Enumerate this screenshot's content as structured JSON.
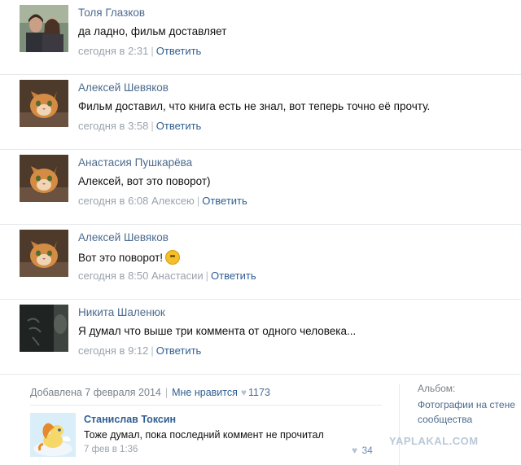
{
  "comments": [
    {
      "author": "Толя Глазков",
      "text": "да ладно, фильм доставляет",
      "date": "сегодня в 2:31",
      "reply_to": "",
      "reply_label": "Ответить",
      "avatar": "couple-photo"
    },
    {
      "author": "Алексей Шевяков",
      "text": "Фильм доставил, что книга есть не знал, вот теперь точно её прочту.",
      "date": "сегодня в 3:58",
      "reply_to": "",
      "reply_label": "Ответить",
      "avatar": "cat-photo"
    },
    {
      "author": "Анастасия Пушкарёва",
      "text": "Алексей, вот это поворот)",
      "date": "сегодня в 6:08",
      "reply_to": "Алексею",
      "reply_label": "Ответить",
      "avatar": "cat-photo"
    },
    {
      "author": "Алексей Шевяков",
      "text": "Вот это поворот!",
      "date": "сегодня в 8:50",
      "reply_to": "Анастасии",
      "reply_label": "Ответить",
      "avatar": "cat-photo",
      "emoji": "smile-emoji"
    },
    {
      "author": "Никита Шаленюк",
      "text": "Я думал что выше три коммента от одного человека...",
      "date": "сегодня в 9:12",
      "reply_to": "",
      "reply_label": "Ответить",
      "avatar": "dark-photo"
    }
  ],
  "post": {
    "added": "Добавлена 7 февраля 2014",
    "like_label": "Мне нравится",
    "like_count": "1173"
  },
  "sub_comment": {
    "author": "Станислав Токсин",
    "text": "Тоже думал, пока последний коммент не прочитал",
    "date": "7 фев в 1:36",
    "likes": "34",
    "avatar": "pony-picture"
  },
  "sidebar": {
    "label": "Альбом:",
    "link": "Фотографии на стене сообщества"
  },
  "watermark": "YAPLAKAL.COM",
  "colors": {
    "link": "#2f5f93",
    "author": "#4c6b8f",
    "meta": "#9aa3ad",
    "divider": "#e7e8ec"
  }
}
